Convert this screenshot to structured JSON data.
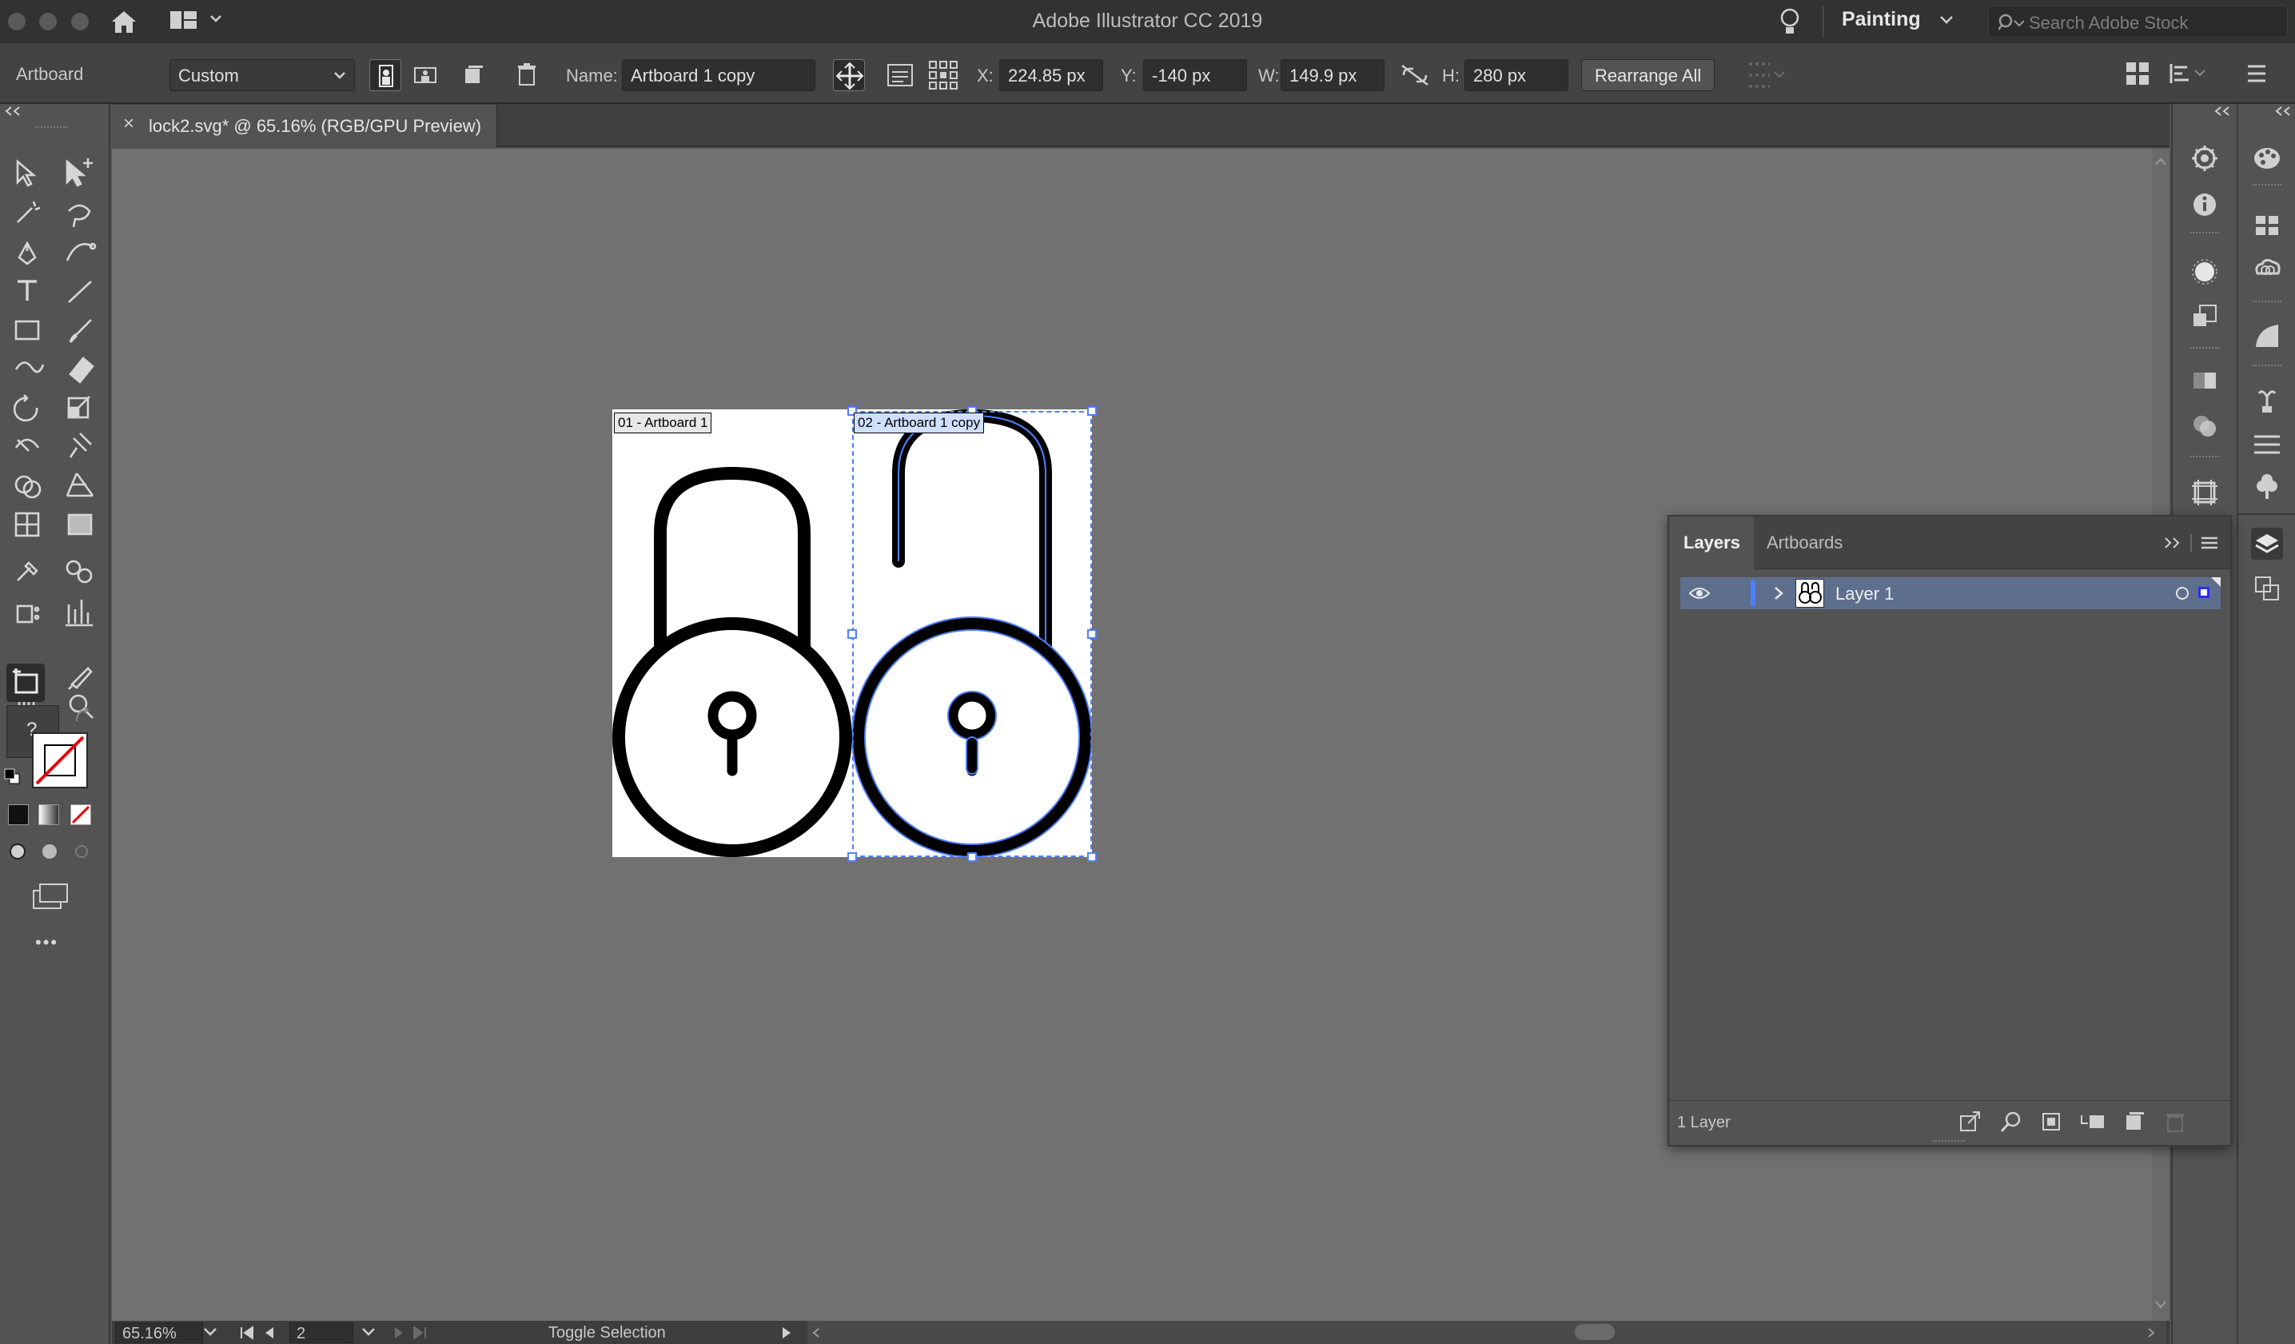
{
  "app_title": "Adobe Illustrator CC 2019",
  "workspace": {
    "label": "Painting"
  },
  "search": {
    "placeholder": "Search Adobe Stock"
  },
  "control_bar": {
    "context_label": "Artboard",
    "preset_value": "Custom",
    "name_label": "Name:",
    "name_value": "Artboard 1 copy",
    "x_label": "X:",
    "x_value": "224.85 px",
    "y_label": "Y:",
    "y_value": "-140 px",
    "w_label": "W:",
    "w_value": "149.9 px",
    "h_label": "H:",
    "h_value": "280 px",
    "rearrange_label": "Rearrange All"
  },
  "document": {
    "tab_title": "lock2.svg* @ 65.16% (RGB/GPU Preview)",
    "close_symbol": "×"
  },
  "artboards": [
    {
      "label": "01 - Artboard 1",
      "icon": "lock-closed-icon",
      "selected": false
    },
    {
      "label": "02 - Artboard 1 copy",
      "icon": "lock-open-icon",
      "selected": true
    }
  ],
  "toolbar": {
    "color_mode_unknown": "?",
    "more_tools": "•••"
  },
  "layers_panel": {
    "tabs": [
      "Layers",
      "Artboards"
    ],
    "active_tab": "Layers",
    "layers": [
      {
        "name": "Layer 1",
        "color": "#4f7fff"
      }
    ],
    "footer_count": "1 Layer"
  },
  "status_bar": {
    "zoom": "65.16%",
    "artboard_number": "2",
    "status_text": "Toggle Selection"
  },
  "colors": {
    "selection_blue": "#4f7fff",
    "canvas": "#717171",
    "ui_dark": "#323232"
  }
}
